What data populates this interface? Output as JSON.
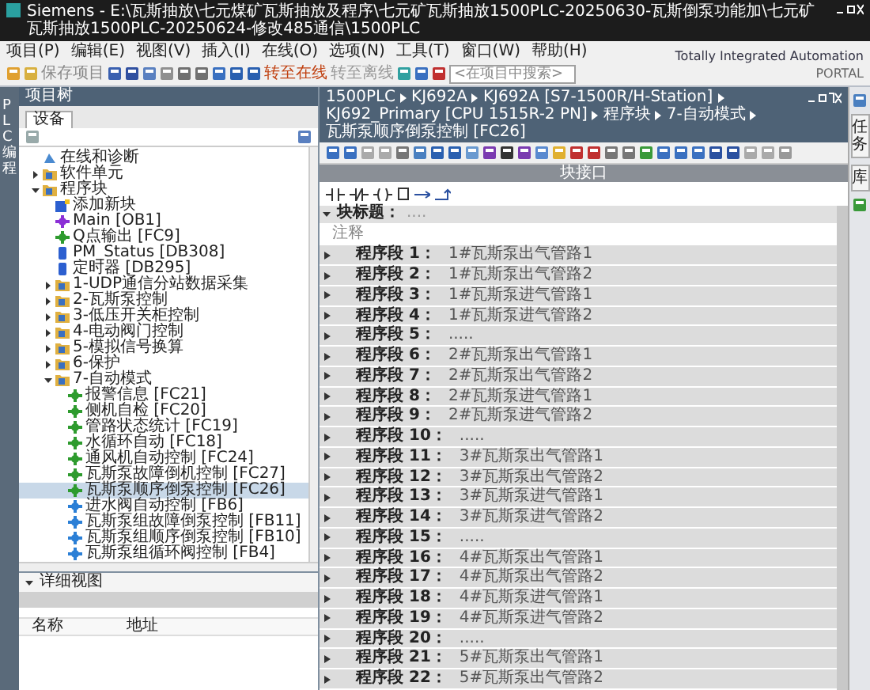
{
  "window": {
    "title": "Siemens - E:\\瓦斯抽放\\七元煤矿瓦斯抽放及程序\\七元矿瓦斯抽放1500PLC-20250630-瓦斯倒泵功能加\\七元矿瓦斯抽放1500PLC-20250624-修改485通信\\1500PLC"
  },
  "menu": [
    "项目(P)",
    "编辑(E)",
    "视图(V)",
    "插入(I)",
    "在线(O)",
    "选项(N)",
    "工具(T)",
    "窗口(W)",
    "帮助(H)"
  ],
  "toolbar": {
    "save": "保存项目",
    "go_online": "转至在线",
    "go_offline": "转至离线",
    "search": {
      "placeholder": "<在项目中搜索>"
    }
  },
  "brand": {
    "line1": "Totally Integrated Automation",
    "line2": "PORTAL"
  },
  "side_tab": "PLC 编程",
  "project_tree": {
    "title": "项目树",
    "tab": "设备",
    "items": [
      {
        "label": "在线和诊断",
        "kind": "online",
        "selected": false
      },
      {
        "label": "软件单元",
        "kind": "folder",
        "expanded": false,
        "selected": false
      },
      {
        "label": "程序块",
        "kind": "folder",
        "expanded": true,
        "selected": false,
        "children": [
          {
            "label": "添加新块",
            "kind": "add",
            "selected": false
          },
          {
            "label": "Main [OB1]",
            "kind": "ob",
            "selected": false
          },
          {
            "label": "Q点输出 [FC9]",
            "kind": "fc",
            "selected": false
          },
          {
            "label": "PM_Status [DB308]",
            "kind": "db",
            "selected": false
          },
          {
            "label": "定时器 [DB295]",
            "kind": "db",
            "selected": false
          },
          {
            "label": "1-UDP通信分站数据采集",
            "kind": "folder",
            "expanded": false,
            "selected": false
          },
          {
            "label": "2-瓦斯泵控制",
            "kind": "folder",
            "expanded": false,
            "selected": false
          },
          {
            "label": "3-低压开关柜控制",
            "kind": "folder",
            "expanded": false,
            "selected": false
          },
          {
            "label": "4-电动阀门控制",
            "kind": "folder",
            "expanded": false,
            "selected": false
          },
          {
            "label": "5-模拟信号换算",
            "kind": "folder",
            "expanded": false,
            "selected": false
          },
          {
            "label": "6-保护",
            "kind": "folder",
            "expanded": false,
            "selected": false
          },
          {
            "label": "7-自动模式",
            "kind": "folder",
            "expanded": true,
            "selected": false,
            "children": [
              {
                "label": "报警信息 [FC21]",
                "kind": "fc",
                "selected": false
              },
              {
                "label": "侧机自检 [FC20]",
                "kind": "fc",
                "selected": false
              },
              {
                "label": "管路状态统计 [FC19]",
                "kind": "fc",
                "selected": false
              },
              {
                "label": "水循环自动 [FC18]",
                "kind": "fc",
                "selected": false
              },
              {
                "label": "通风机自动控制 [FC24]",
                "kind": "fc",
                "selected": false
              },
              {
                "label": "瓦斯泵故障倒机控制 [FC27]",
                "kind": "fc",
                "selected": false
              },
              {
                "label": "瓦斯泵顺序倒泵控制 [FC26]",
                "kind": "fc",
                "selected": true
              },
              {
                "label": "进水阀自动控制 [FB6]",
                "kind": "fb",
                "selected": false
              },
              {
                "label": "瓦斯泵组故障倒泵控制 [FB11]",
                "kind": "fb",
                "selected": false
              },
              {
                "label": "瓦斯泵组顺序倒泵控制 [FB10]",
                "kind": "fb",
                "selected": false
              },
              {
                "label": "瓦斯泵组循环阀控制 [FB4]",
                "kind": "fb",
                "selected": false
              }
            ]
          }
        ]
      }
    ]
  },
  "details": {
    "title": "详细视图",
    "columns": [
      "名称",
      "地址"
    ]
  },
  "breadcrumb": [
    "1500PLC",
    "KJ692A",
    "KJ692A [S7-1500R/H-Station]",
    "KJ692_Primary [CPU 1515R-2 PN]",
    "程序块",
    "7-自动模式",
    "瓦斯泵顺序倒泵控制 [FC26]"
  ],
  "interface_bar": "块接口",
  "right_tabs": [
    "任务",
    "库"
  ],
  "block": {
    "title_label": "块标题：",
    "title": "....",
    "comment": "注释"
  },
  "segments": [
    {
      "label": "程序段 1：",
      "comment": "1#瓦斯泵出气管路1"
    },
    {
      "label": "程序段 2：",
      "comment": "1#瓦斯泵出气管路2"
    },
    {
      "label": "程序段 3：",
      "comment": "1#瓦斯泵进气管路1"
    },
    {
      "label": "程序段 4：",
      "comment": "1#瓦斯泵进气管路2"
    },
    {
      "label": "程序段 5：",
      "comment": "....."
    },
    {
      "label": "程序段 6：",
      "comment": "2#瓦斯泵出气管路1"
    },
    {
      "label": "程序段 7：",
      "comment": "2#瓦斯泵出气管路2"
    },
    {
      "label": "程序段 8：",
      "comment": "2#瓦斯泵进气管路1"
    },
    {
      "label": "程序段 9：",
      "comment": "2#瓦斯泵进气管路2"
    },
    {
      "label": "程序段 10：",
      "comment": "....."
    },
    {
      "label": "程序段 11：",
      "comment": "3#瓦斯泵出气管路1"
    },
    {
      "label": "程序段 12：",
      "comment": "3#瓦斯泵出气管路2"
    },
    {
      "label": "程序段 13：",
      "comment": "3#瓦斯泵进气管路1"
    },
    {
      "label": "程序段 14：",
      "comment": "3#瓦斯泵进气管路2"
    },
    {
      "label": "程序段 15：",
      "comment": "....."
    },
    {
      "label": "程序段 16：",
      "comment": "4#瓦斯泵出气管路1"
    },
    {
      "label": "程序段 17：",
      "comment": "4#瓦斯泵出气管路2"
    },
    {
      "label": "程序段 18：",
      "comment": "4#瓦斯泵进气管路1"
    },
    {
      "label": "程序段 19：",
      "comment": "4#瓦斯泵进气管路2"
    },
    {
      "label": "程序段 20：",
      "comment": "....."
    },
    {
      "label": "程序段 21：",
      "comment": "5#瓦斯泵出气管路1"
    },
    {
      "label": "程序段 22：",
      "comment": "5#瓦斯泵出气管路2"
    }
  ]
}
